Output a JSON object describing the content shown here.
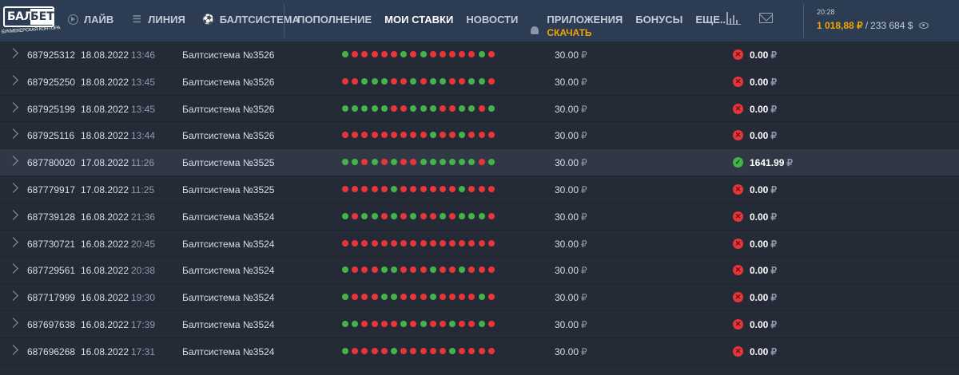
{
  "header": {
    "logo": {
      "word1": "БАЛТ",
      "word2": "БЕТ",
      "subtitle": "БУКМЕКЕРСКАЯ КОНТОРА"
    },
    "nav_left": [
      {
        "label": "ЛАЙВ",
        "icon": "live-play-icon"
      },
      {
        "label": "ЛИНИЯ",
        "icon": "list-icon"
      },
      {
        "label": "БАЛТСИСТЕМА",
        "icon": "football-icon"
      }
    ],
    "nav_mid": [
      {
        "label": "ПОПОЛНЕНИЕ",
        "active": false
      },
      {
        "label": "МОИ СТАВКИ",
        "active": true
      },
      {
        "label": "НОВОСТИ",
        "active": false
      }
    ],
    "apps_label": "ПРИЛОЖЕНИЯ",
    "download_label": "СКАЧАТЬ",
    "nav_right": [
      {
        "label": "БОНУСЫ"
      },
      {
        "label": "ЕЩЕ..."
      }
    ],
    "time": "20:28",
    "balance_money": "1 018,88 ₽",
    "balance_sep": "/",
    "balance_bonus": "233 684 $"
  },
  "colors": {
    "win": "#44b34a",
    "loss": "#e8353a",
    "accent": "#f2a400",
    "header_bg": "#2c3c52"
  },
  "bets": [
    {
      "id": "687925312",
      "date": "18.08.2022",
      "time": "13:46",
      "name": "Балтсистема №3526",
      "dots": "grrrrrgrgrrrrrgr",
      "stake": "30.00",
      "result": "loss",
      "win": "0.00"
    },
    {
      "id": "687925250",
      "date": "18.08.2022",
      "time": "13:45",
      "name": "Балтсистема №3526",
      "dots": "rrgggrrgrggrrggr",
      "stake": "30.00",
      "result": "loss",
      "win": "0.00"
    },
    {
      "id": "687925199",
      "date": "18.08.2022",
      "time": "13:45",
      "name": "Балтсистема №3526",
      "dots": "gggggrrgggrrggrg",
      "stake": "30.00",
      "result": "loss",
      "win": "0.00"
    },
    {
      "id": "687925116",
      "date": "18.08.2022",
      "time": "13:44",
      "name": "Балтсистема №3526",
      "dots": "rrrrrrrrrgrrgrrr",
      "stake": "30.00",
      "result": "loss",
      "win": "0.00"
    },
    {
      "id": "687780020",
      "date": "17.08.2022",
      "time": "11:26",
      "name": "Балтсистема №3525",
      "dots": "ggrgrgrrggggggrg",
      "stake": "30.00",
      "result": "win",
      "win": "1641.99"
    },
    {
      "id": "687779917",
      "date": "17.08.2022",
      "time": "11:25",
      "name": "Балтсистема №3525",
      "dots": "rrrrrgrrrrrrgrrr",
      "stake": "30.00",
      "result": "loss",
      "win": "0.00"
    },
    {
      "id": "687739128",
      "date": "16.08.2022",
      "time": "21:36",
      "name": "Балтсистема №3524",
      "dots": "grggrgrgrrgrgggr",
      "stake": "30.00",
      "result": "loss",
      "win": "0.00"
    },
    {
      "id": "687730721",
      "date": "16.08.2022",
      "time": "20:45",
      "name": "Балтсистема №3524",
      "dots": "rrrrrrrrrrrrrrrr",
      "stake": "30.00",
      "result": "loss",
      "win": "0.00"
    },
    {
      "id": "687729561",
      "date": "16.08.2022",
      "time": "20:38",
      "name": "Балтсистема №3524",
      "dots": "grrrggrrrgrrgrrr",
      "stake": "30.00",
      "result": "loss",
      "win": "0.00"
    },
    {
      "id": "687717999",
      "date": "16.08.2022",
      "time": "19:30",
      "name": "Балтсистема №3524",
      "dots": "grrrggrrrgrrrrgr",
      "stake": "30.00",
      "result": "loss",
      "win": "0.00"
    },
    {
      "id": "687697638",
      "date": "16.08.2022",
      "time": "17:39",
      "name": "Балтсистема №3524",
      "dots": "ggrrrrgrgrrgrrgr",
      "stake": "30.00",
      "result": "loss",
      "win": "0.00"
    },
    {
      "id": "687696268",
      "date": "16.08.2022",
      "time": "17:31",
      "name": "Балтсистема №3524",
      "dots": "grrrrgrrrrrgrrrr",
      "stake": "30.00",
      "result": "loss",
      "win": "0.00"
    }
  ],
  "currency": "₽"
}
